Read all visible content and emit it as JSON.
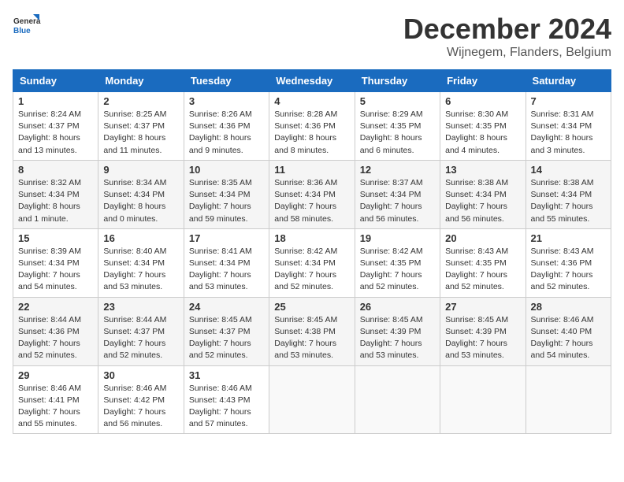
{
  "logo": {
    "general": "General",
    "blue": "Blue"
  },
  "header": {
    "title": "December 2024",
    "subtitle": "Wijnegem, Flanders, Belgium"
  },
  "weekdays": [
    "Sunday",
    "Monday",
    "Tuesday",
    "Wednesday",
    "Thursday",
    "Friday",
    "Saturday"
  ],
  "weeks": [
    [
      {
        "day": "1",
        "sunrise": "8:24 AM",
        "sunset": "4:37 PM",
        "daylight": "8 hours and 13 minutes."
      },
      {
        "day": "2",
        "sunrise": "8:25 AM",
        "sunset": "4:37 PM",
        "daylight": "8 hours and 11 minutes."
      },
      {
        "day": "3",
        "sunrise": "8:26 AM",
        "sunset": "4:36 PM",
        "daylight": "8 hours and 9 minutes."
      },
      {
        "day": "4",
        "sunrise": "8:28 AM",
        "sunset": "4:36 PM",
        "daylight": "8 hours and 8 minutes."
      },
      {
        "day": "5",
        "sunrise": "8:29 AM",
        "sunset": "4:35 PM",
        "daylight": "8 hours and 6 minutes."
      },
      {
        "day": "6",
        "sunrise": "8:30 AM",
        "sunset": "4:35 PM",
        "daylight": "8 hours and 4 minutes."
      },
      {
        "day": "7",
        "sunrise": "8:31 AM",
        "sunset": "4:34 PM",
        "daylight": "8 hours and 3 minutes."
      }
    ],
    [
      {
        "day": "8",
        "sunrise": "8:32 AM",
        "sunset": "4:34 PM",
        "daylight": "8 hours and 1 minute."
      },
      {
        "day": "9",
        "sunrise": "8:34 AM",
        "sunset": "4:34 PM",
        "daylight": "8 hours and 0 minutes."
      },
      {
        "day": "10",
        "sunrise": "8:35 AM",
        "sunset": "4:34 PM",
        "daylight": "7 hours and 59 minutes."
      },
      {
        "day": "11",
        "sunrise": "8:36 AM",
        "sunset": "4:34 PM",
        "daylight": "7 hours and 58 minutes."
      },
      {
        "day": "12",
        "sunrise": "8:37 AM",
        "sunset": "4:34 PM",
        "daylight": "7 hours and 56 minutes."
      },
      {
        "day": "13",
        "sunrise": "8:38 AM",
        "sunset": "4:34 PM",
        "daylight": "7 hours and 56 minutes."
      },
      {
        "day": "14",
        "sunrise": "8:38 AM",
        "sunset": "4:34 PM",
        "daylight": "7 hours and 55 minutes."
      }
    ],
    [
      {
        "day": "15",
        "sunrise": "8:39 AM",
        "sunset": "4:34 PM",
        "daylight": "7 hours and 54 minutes."
      },
      {
        "day": "16",
        "sunrise": "8:40 AM",
        "sunset": "4:34 PM",
        "daylight": "7 hours and 53 minutes."
      },
      {
        "day": "17",
        "sunrise": "8:41 AM",
        "sunset": "4:34 PM",
        "daylight": "7 hours and 53 minutes."
      },
      {
        "day": "18",
        "sunrise": "8:42 AM",
        "sunset": "4:34 PM",
        "daylight": "7 hours and 52 minutes."
      },
      {
        "day": "19",
        "sunrise": "8:42 AM",
        "sunset": "4:35 PM",
        "daylight": "7 hours and 52 minutes."
      },
      {
        "day": "20",
        "sunrise": "8:43 AM",
        "sunset": "4:35 PM",
        "daylight": "7 hours and 52 minutes."
      },
      {
        "day": "21",
        "sunrise": "8:43 AM",
        "sunset": "4:36 PM",
        "daylight": "7 hours and 52 minutes."
      }
    ],
    [
      {
        "day": "22",
        "sunrise": "8:44 AM",
        "sunset": "4:36 PM",
        "daylight": "7 hours and 52 minutes."
      },
      {
        "day": "23",
        "sunrise": "8:44 AM",
        "sunset": "4:37 PM",
        "daylight": "7 hours and 52 minutes."
      },
      {
        "day": "24",
        "sunrise": "8:45 AM",
        "sunset": "4:37 PM",
        "daylight": "7 hours and 52 minutes."
      },
      {
        "day": "25",
        "sunrise": "8:45 AM",
        "sunset": "4:38 PM",
        "daylight": "7 hours and 53 minutes."
      },
      {
        "day": "26",
        "sunrise": "8:45 AM",
        "sunset": "4:39 PM",
        "daylight": "7 hours and 53 minutes."
      },
      {
        "day": "27",
        "sunrise": "8:45 AM",
        "sunset": "4:39 PM",
        "daylight": "7 hours and 53 minutes."
      },
      {
        "day": "28",
        "sunrise": "8:46 AM",
        "sunset": "4:40 PM",
        "daylight": "7 hours and 54 minutes."
      }
    ],
    [
      {
        "day": "29",
        "sunrise": "8:46 AM",
        "sunset": "4:41 PM",
        "daylight": "7 hours and 55 minutes."
      },
      {
        "day": "30",
        "sunrise": "8:46 AM",
        "sunset": "4:42 PM",
        "daylight": "7 hours and 56 minutes."
      },
      {
        "day": "31",
        "sunrise": "8:46 AM",
        "sunset": "4:43 PM",
        "daylight": "7 hours and 57 minutes."
      },
      null,
      null,
      null,
      null
    ]
  ]
}
